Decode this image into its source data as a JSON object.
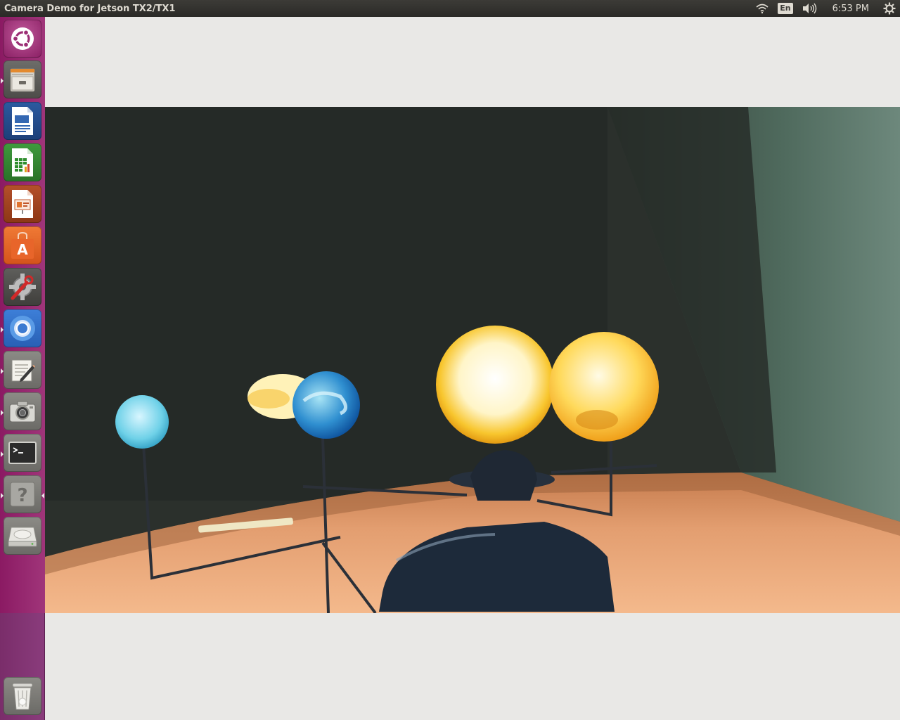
{
  "window": {
    "title": "Camera Demo for Jetson TX2/TX1"
  },
  "panel": {
    "keyboard_layout": "En",
    "clock": "6:53 PM",
    "icons": [
      "wifi-icon",
      "keyboard-layout-icon",
      "volume-icon",
      "session-gear-icon"
    ]
  },
  "launcher": {
    "items": [
      {
        "name": "dash-home",
        "icon": "ubuntu-logo-icon",
        "running": false
      },
      {
        "name": "files",
        "icon": "file-cabinet-icon",
        "running": true
      },
      {
        "name": "libreoffice-writer",
        "icon": "writer-document-icon",
        "running": false
      },
      {
        "name": "libreoffice-calc",
        "icon": "calc-spreadsheet-icon",
        "running": false
      },
      {
        "name": "libreoffice-impress",
        "icon": "impress-presentation-icon",
        "running": false
      },
      {
        "name": "software-center",
        "icon": "shopping-bag-icon",
        "running": false
      },
      {
        "name": "system-settings",
        "icon": "wrench-gear-icon",
        "running": false
      },
      {
        "name": "chromium",
        "icon": "chromium-icon",
        "running": true
      },
      {
        "name": "text-editor",
        "icon": "notepad-pencil-icon",
        "running": true
      },
      {
        "name": "camera-demo",
        "icon": "camera-icon",
        "running": true
      },
      {
        "name": "terminal",
        "icon": "terminal-icon",
        "running": true
      },
      {
        "name": "help",
        "icon": "help-question-icon",
        "running": true,
        "active": true
      },
      {
        "name": "drive",
        "icon": "hard-drive-icon",
        "running": false
      }
    ],
    "trash": {
      "icon": "trash-icon"
    }
  },
  "colors": {
    "launcher_top": "#8b1a63",
    "launcher_bottom": "#7a2d6a",
    "panel": "#3c3b37",
    "desktop": "#e9e8e6"
  }
}
